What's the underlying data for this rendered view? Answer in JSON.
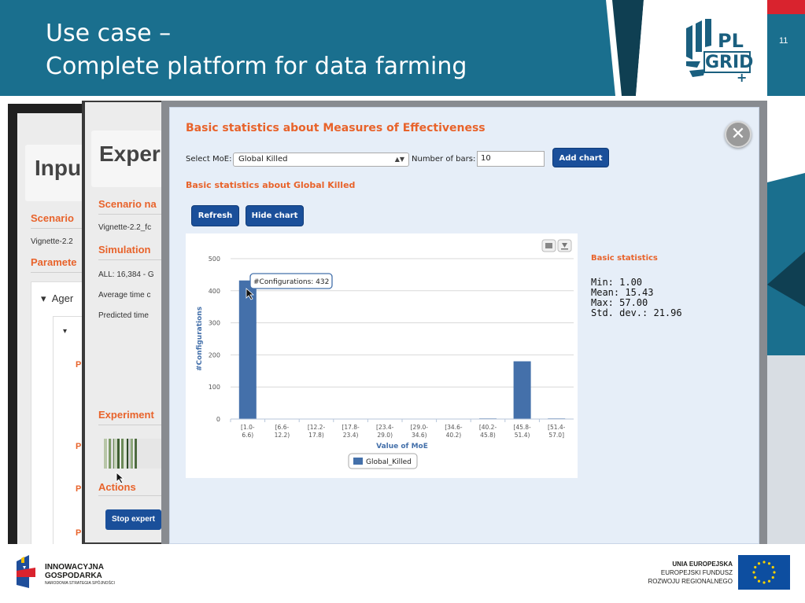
{
  "slide": {
    "title_line1": "Use case –",
    "title_line2": "Complete platform for data farming",
    "page_number": "11",
    "colors": {
      "header": "#1a6f8e",
      "accent_dark": "#0f3f52",
      "brand_red": "#d9232e",
      "modal_orange": "#e8632b",
      "button_blue": "#1a4f9a"
    }
  },
  "logo": {
    "name": "PL-Grid plus logo",
    "line1": "PL",
    "line2": "GRID",
    "plus": "+"
  },
  "bg_panel_input": {
    "title": "Inpu",
    "scenario": "Scenario",
    "vignette": "Vignette-2.2",
    "parameters": "Paramete",
    "tree_item": "Ager",
    "p_letters": [
      "P",
      "P",
      "P",
      "P"
    ]
  },
  "bg_panel_experiment": {
    "title": "Exper",
    "scenario": "Scenario na",
    "vignette": "Vignette-2.2_fc",
    "simulation": "Simulation",
    "all": "ALL: 16,384 - G",
    "avg_time": "Average time c",
    "predicted_time": "Predicted time",
    "experiment": "Experiment",
    "actions": "Actions",
    "stop_button": "Stop expert"
  },
  "modal": {
    "title": "Basic statistics about Measures of Effectiveness",
    "close_icon": "close-icon",
    "select_label": "Select MoE:",
    "select_value": "Global Killed",
    "bars_label": "Number of bars:",
    "bars_value": "10",
    "add_chart": "Add chart",
    "subtitle": "Basic statistics about Global Killed",
    "refresh": "Refresh",
    "hide_chart": "Hide chart",
    "stats": {
      "title": "Basic statistics",
      "min": "Min: 1.00",
      "mean": "Mean: 15.43",
      "max": "Max: 57.00",
      "std": "Std. dev.: 21.96"
    },
    "tooltip": "#Configurations: 432",
    "chart_icons": [
      "print-icon",
      "download-icon"
    ]
  },
  "chart_data": {
    "type": "bar",
    "categories": [
      [
        "[1.0-",
        "6.6)"
      ],
      [
        "[6.6-",
        "12.2)"
      ],
      [
        "[12.2-",
        "17.8)"
      ],
      [
        "[17.8-",
        "23.4)"
      ],
      [
        "[23.4-",
        "29.0)"
      ],
      [
        "[29.0-",
        "34.6)"
      ],
      [
        "[34.6-",
        "40.2)"
      ],
      [
        "[40.2-",
        "45.8)"
      ],
      [
        "[45.8-",
        "51.4)"
      ],
      [
        "[51.4-",
        "57.0]"
      ]
    ],
    "series": [
      {
        "name": "Global_Killed",
        "values": [
          432,
          0,
          0,
          0,
          0,
          0,
          0,
          2,
          180,
          2
        ]
      }
    ],
    "xlabel": "Value of MoE",
    "ylabel": "#Configurations",
    "ylim": [
      0,
      500
    ],
    "yticks": [
      0,
      100,
      200,
      300,
      400,
      500
    ],
    "grid": true,
    "legend": "bottom-center",
    "bar_color": "#4470aa"
  },
  "footer": {
    "left_line1": "INNOWACYJNA",
    "left_line2": "GOSPODARKA",
    "left_line3": "NARODOWA STRATEGIA SPÓJNOŚCI",
    "right_line1": "UNIA EUROPEJSKA",
    "right_line2": "EUROPEJSKI FUNDUSZ",
    "right_line3": "ROZWOJU REGIONALNEGO",
    "flag_icon": "eu-flag-icon"
  }
}
